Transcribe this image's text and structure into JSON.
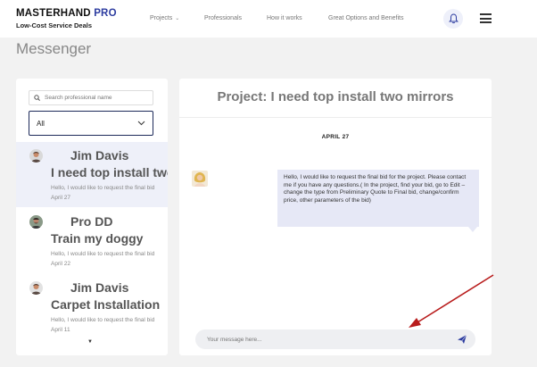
{
  "header": {
    "brand_main": "MASTERHAND",
    "brand_accent": "PRO",
    "tagline": "Low-Cost Service Deals",
    "nav": [
      {
        "label": "Projects",
        "has_caret": true
      },
      {
        "label": "Professionals"
      },
      {
        "label": "How it works"
      },
      {
        "label": "Great Options and Benefits"
      }
    ],
    "icons": {
      "notifications": "bell-icon",
      "menu": "hamburger-icon"
    }
  },
  "page_title": "Messenger",
  "sidebar": {
    "search_placeholder": "Search professional name",
    "filter_value": "All",
    "conversations": [
      {
        "name": "Jim Davis",
        "project": "I need top install two mirrors",
        "preview": "Hello, I would like to request the final bid",
        "date": "April 27",
        "active": true
      },
      {
        "name": "Pro DD",
        "project": "Train my doggy",
        "preview": "Hello, I would like to request the final bid",
        "date": "April 22",
        "active": false
      },
      {
        "name": "Jim Davis",
        "project": "Carpet Installation",
        "preview": "Hello, I would like to request the final bid",
        "date": "April 11",
        "active": false
      }
    ]
  },
  "chat": {
    "title": "Project: I need top install two mirrors",
    "date_divider": "APRIL 27",
    "message": "Hello, I would like to request the final bid for the project. Please contact me if you have any questions.( In the project, find your bid, go to Edit – change the type from Preliminary Quote to Final bid, change/confirm price, other parameters of the bid)",
    "composer_placeholder": "Your message here..."
  },
  "colors": {
    "brand_accent": "#2e3da0",
    "bubble_bg": "#e6e8f6",
    "active_row": "#eef0f9",
    "annotation_arrow": "#b81c1c",
    "send_icon": "#2e3da0"
  }
}
